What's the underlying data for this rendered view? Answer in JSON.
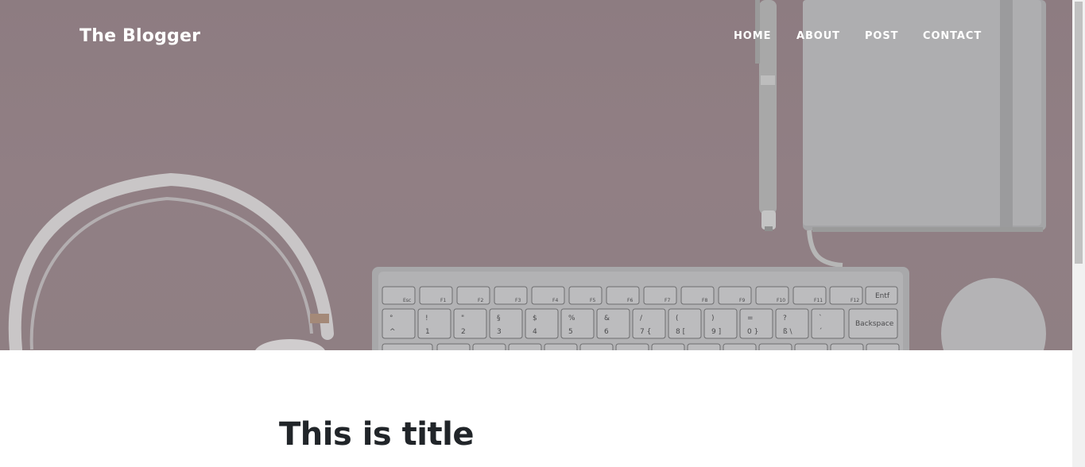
{
  "header": {
    "brand": "The Blogger",
    "nav": [
      "HOME",
      "ABOUT",
      "POST",
      "CONTACT"
    ]
  },
  "keyboard": {
    "fn_row": [
      "Esc",
      "F1",
      "F2",
      "F3",
      "F4",
      "F5",
      "F6",
      "F7",
      "F8",
      "F9",
      "F10",
      "F11",
      "F12",
      "Entf"
    ],
    "num_row_top": [
      "°",
      "!",
      "\"",
      "§",
      "$",
      "%",
      "&",
      "/",
      "(",
      ")",
      "=",
      "?",
      "`"
    ],
    "num_row_bottom": [
      "^",
      "1",
      "2",
      "3",
      "4",
      "5",
      "6",
      "7 {",
      "8 [",
      "9 ]",
      "0 }",
      "ß \\",
      "´"
    ],
    "backspace": "Backspace"
  },
  "main": {
    "title": "This is title"
  },
  "colors": {
    "hero_overlay": "#8f7f83",
    "title_text": "#212529",
    "nav_text": "#ffffff"
  }
}
